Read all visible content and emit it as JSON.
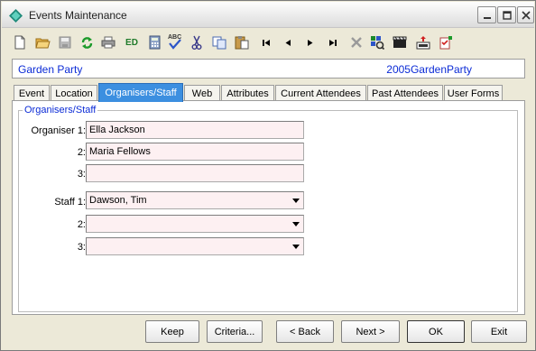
{
  "window": {
    "title": "Events Maintenance"
  },
  "toolbar": {
    "buttons": [
      {
        "icon": "new-document-icon"
      },
      {
        "icon": "open-folder-icon"
      },
      {
        "icon": "save-icon"
      },
      {
        "icon": "refresh-icon"
      },
      {
        "icon": "print-icon"
      },
      {
        "icon": "edit-id-icon",
        "text": "ED"
      },
      {
        "icon": "calculator-icon"
      },
      {
        "icon": "spell-check-icon",
        "text": "ABC"
      },
      {
        "icon": "cut-icon"
      },
      {
        "icon": "copy-icon"
      },
      {
        "icon": "paste-icon"
      },
      {
        "icon": "first-record-icon"
      },
      {
        "icon": "previous-record-icon"
      },
      {
        "icon": "next-record-icon"
      },
      {
        "icon": "last-record-icon"
      },
      {
        "icon": "delete-icon"
      },
      {
        "icon": "find-icon"
      },
      {
        "icon": "clapboard-icon"
      },
      {
        "icon": "import-icon"
      },
      {
        "icon": "add-task-icon"
      }
    ]
  },
  "header": {
    "title": "Garden Party",
    "code": "2005GardenParty"
  },
  "tabs": [
    {
      "label": "Event"
    },
    {
      "label": "Location"
    },
    {
      "label": "Organisers/Staff",
      "active": true
    },
    {
      "label": "Web"
    },
    {
      "label": "Attributes"
    },
    {
      "label": "Current Attendees"
    },
    {
      "label": "Past Attendees"
    },
    {
      "label": "User Forms"
    }
  ],
  "organisers": {
    "group_title": "Organisers/Staff",
    "organiser1_label": "Organiser 1:",
    "organiser1_value": "Ella Jackson",
    "organiser2_label": "2:",
    "organiser2_value": "Maria Fellows",
    "organiser3_label": "3:",
    "organiser3_value": "",
    "staff1_label": "Staff 1:",
    "staff1_value": "Dawson, Tim",
    "staff2_label": "2:",
    "staff2_value": "",
    "staff3_label": "3:",
    "staff3_value": ""
  },
  "buttons": {
    "keep": "Keep",
    "criteria": "Criteria...",
    "back": "< Back",
    "next": "Next >",
    "ok": "OK",
    "exit": "Exit"
  },
  "colors": {
    "accent_tab": "#3c8fe0",
    "header_text": "#0b2bd6",
    "field_bg": "#fdf0f2"
  }
}
